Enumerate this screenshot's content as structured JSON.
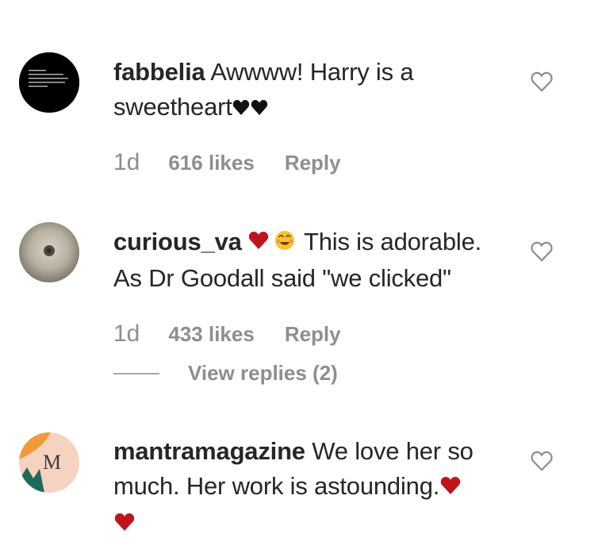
{
  "comments": [
    {
      "username": "fabbelia",
      "text": "Awwww! Harry is a sweetheart",
      "time": "1d",
      "likes": "616 likes",
      "reply_label": "Reply",
      "avatar_icon": "profile-avatar-dark",
      "trailing_emoji": "black-hearts-icon"
    },
    {
      "username": "curious_va",
      "text": "This is adorable. As Dr Goodall said \"we clicked\"",
      "time": "1d",
      "likes": "433 likes",
      "reply_label": "Reply",
      "avatar_icon": "profile-avatar-gray",
      "leading_emoji": "red-heart-and-smiley-icon",
      "view_replies": "View replies (2)"
    },
    {
      "username": "mantramagazine",
      "text": "We love her so much. Her work is astounding.",
      "avatar_icon": "profile-avatar-mantra",
      "trailing_emoji": "red-hearts-icon",
      "avatar_letter": "M"
    }
  ],
  "colors": {
    "text": "#262626",
    "meta": "#8e8e8e",
    "heart_red": "#c0141c",
    "like_outline": "#8e8e8e"
  }
}
